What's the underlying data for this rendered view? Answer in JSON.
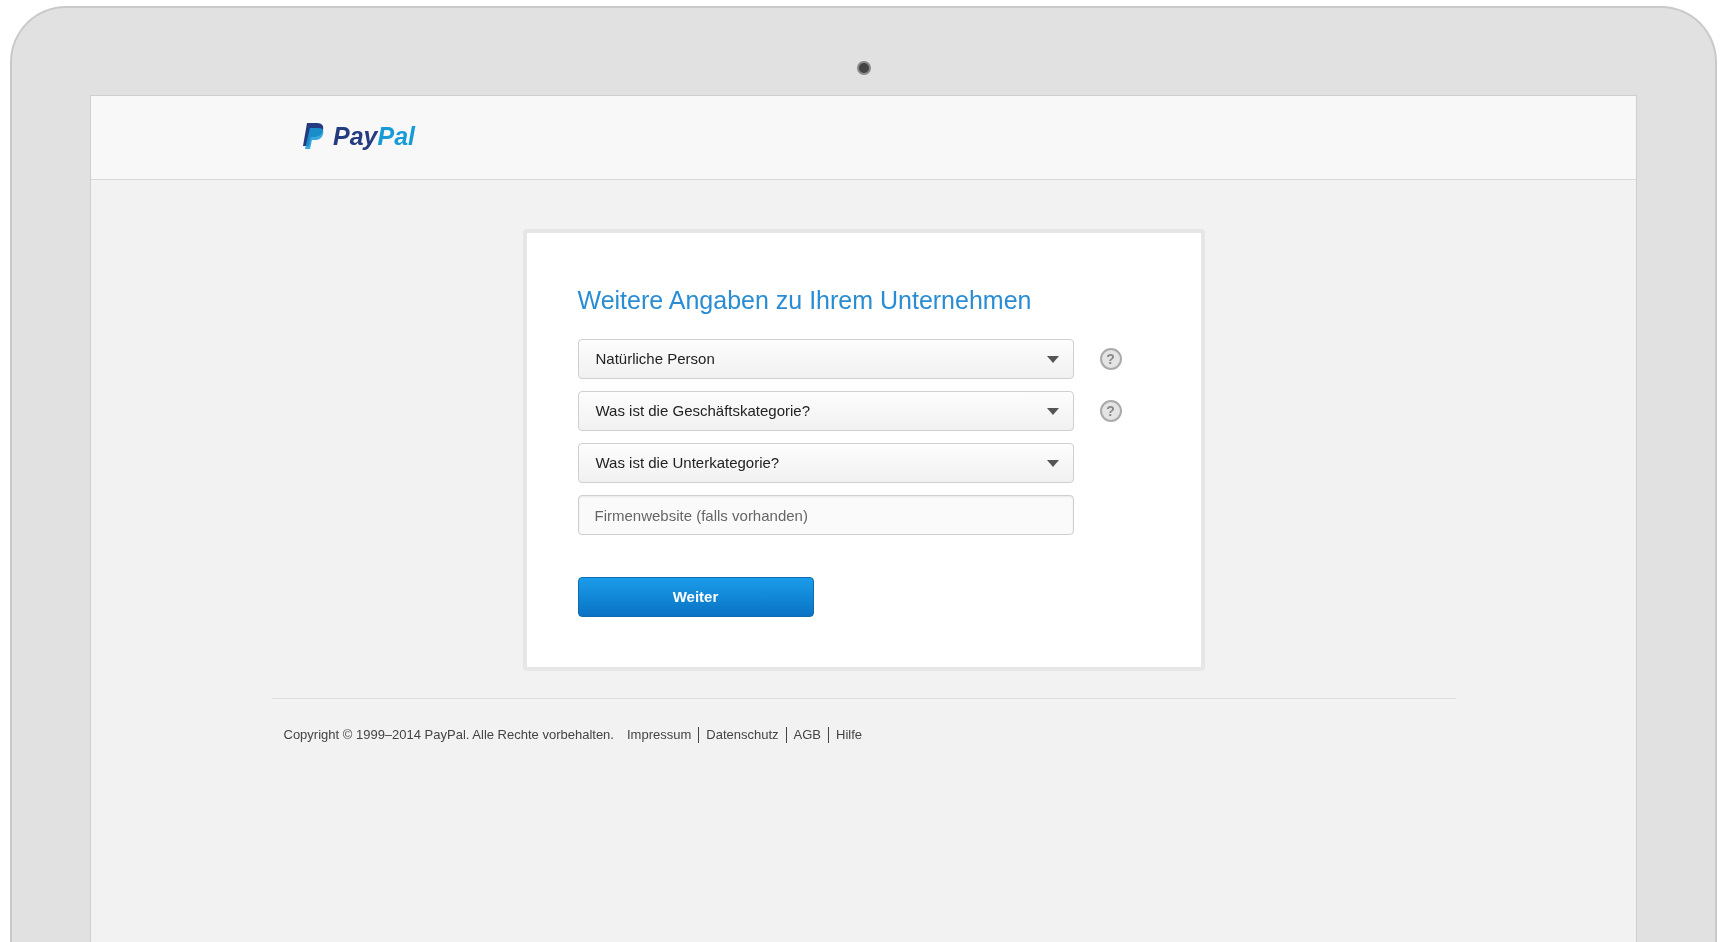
{
  "logo": {
    "parts": [
      "Pay",
      "Pal"
    ]
  },
  "form": {
    "title": "Weitere Angaben zu Ihrem Unternehmen",
    "fields": [
      {
        "kind": "select",
        "value": "Natürliche Person",
        "help": "?"
      },
      {
        "kind": "select",
        "value": "Was ist die Geschäftskategorie?",
        "help": "?"
      },
      {
        "kind": "select",
        "value": "Was ist die Unterkategorie?"
      },
      {
        "kind": "input",
        "placeholder": "Firmenwebsite (falls vorhanden)"
      }
    ],
    "submit": "Weiter"
  },
  "footer": {
    "copyright": "Copyright © 1999–2014 PayPal. Alle Rechte vorbehalten.",
    "links": [
      "Impressum",
      "Datenschutz",
      "AGB",
      "Hilfe"
    ]
  }
}
